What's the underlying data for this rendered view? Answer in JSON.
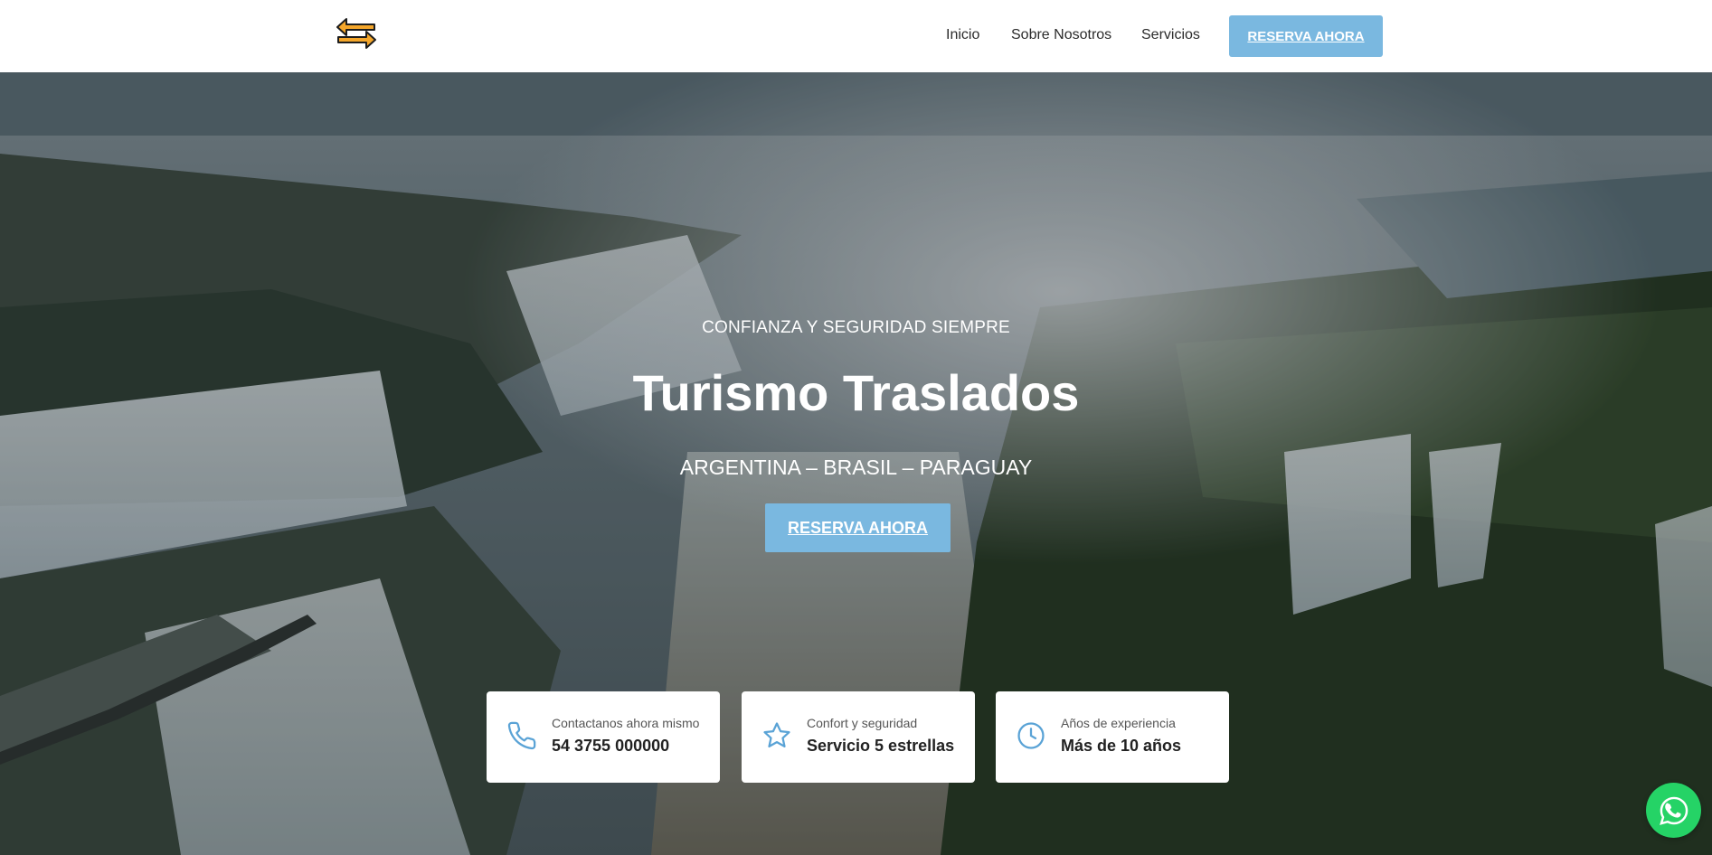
{
  "header": {
    "logo_icon": "double-arrow-logo-icon",
    "nav": [
      {
        "label": "Inicio"
      },
      {
        "label": "Sobre Nosotros"
      },
      {
        "label": "Servicios"
      }
    ],
    "cta_label": "RESERVA AHORA"
  },
  "hero": {
    "eyebrow": "CONFIANZA Y SEGURIDAD SIEMPRE",
    "title": "Turismo Traslados",
    "subtitle": "ARGENTINA – BRASIL – PARAGUAY",
    "cta_label": "RESERVA AHORA"
  },
  "cards": [
    {
      "icon": "phone-icon",
      "label": "Contactanos ahora mismo",
      "value": "54 3755 000000"
    },
    {
      "icon": "star-icon",
      "label": "Confort y seguridad",
      "value": "Servicio 5 estrellas"
    },
    {
      "icon": "clock-icon",
      "label": "Años de experiencia",
      "value": "Más de 10 años"
    }
  ],
  "whatsapp_icon": "whatsapp-icon",
  "colors": {
    "accent": "#7ab8e0",
    "logo_orange": "#f4a62a",
    "card_icon": "#5aa3d6",
    "whatsapp": "#25d366"
  }
}
